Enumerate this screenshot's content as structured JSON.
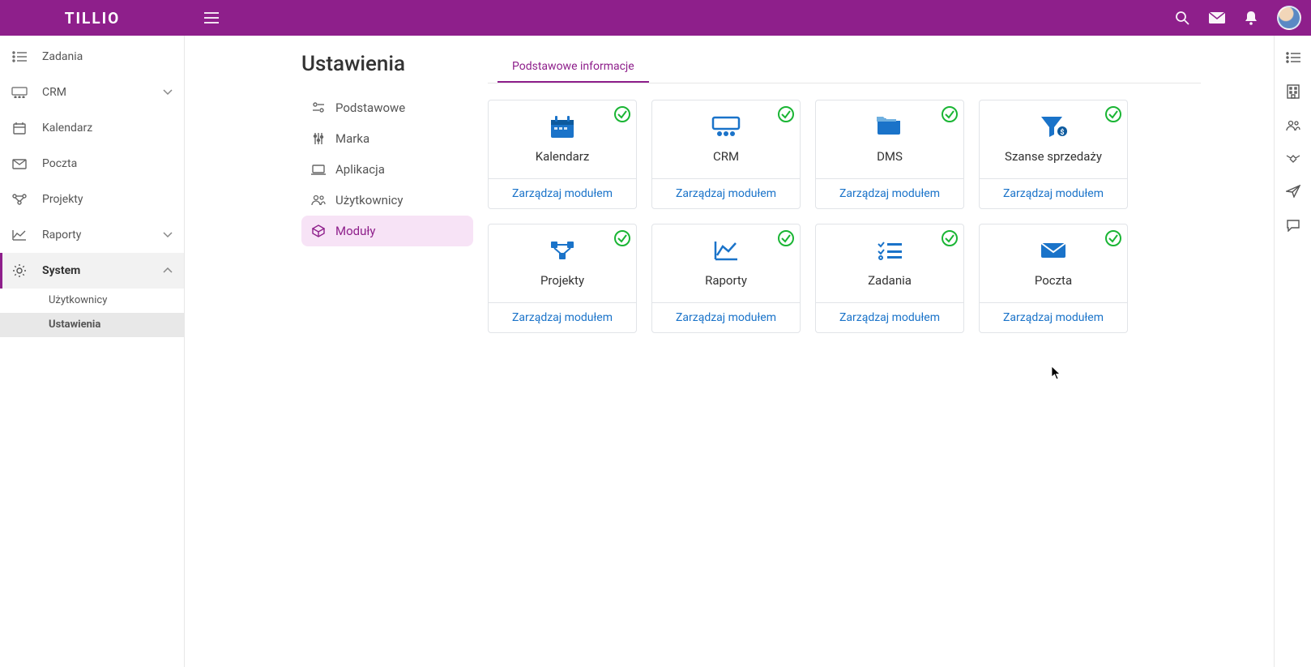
{
  "brand": "TILLIO",
  "sidebar": {
    "items": [
      {
        "label": "Zadania",
        "icon": "list",
        "expandable": false
      },
      {
        "label": "CRM",
        "icon": "crm",
        "expandable": true
      },
      {
        "label": "Kalendarz",
        "icon": "calendar",
        "expandable": false
      },
      {
        "label": "Poczta",
        "icon": "mail",
        "expandable": false
      },
      {
        "label": "Projekty",
        "icon": "projects",
        "expandable": false
      },
      {
        "label": "Raporty",
        "icon": "reports",
        "expandable": true
      },
      {
        "label": "System",
        "icon": "gear",
        "expandable": true,
        "active": true
      }
    ],
    "subitems": [
      {
        "label": "Użytkownicy"
      },
      {
        "label": "Ustawienia",
        "active": true
      }
    ]
  },
  "page_title": "Ustawienia",
  "settings_nav": [
    {
      "label": "Podstawowe",
      "icon": "sliders"
    },
    {
      "label": "Marka",
      "icon": "brand"
    },
    {
      "label": "Aplikacja",
      "icon": "app"
    },
    {
      "label": "Użytkownicy",
      "icon": "users"
    },
    {
      "label": "Moduły",
      "icon": "box",
      "active": true
    }
  ],
  "active_tab": "Podstawowe informacje",
  "manage_label": "Zarządzaj modułem",
  "modules": [
    {
      "name": "Kalendarz",
      "icon": "calendar",
      "enabled": true
    },
    {
      "name": "CRM",
      "icon": "crm",
      "enabled": true
    },
    {
      "name": "DMS",
      "icon": "dms",
      "enabled": true
    },
    {
      "name": "Szanse sprzedaży",
      "icon": "funnel",
      "enabled": true
    },
    {
      "name": "Projekty",
      "icon": "projects",
      "enabled": true
    },
    {
      "name": "Raporty",
      "icon": "reports",
      "enabled": true
    },
    {
      "name": "Zadania",
      "icon": "tasks",
      "enabled": true
    },
    {
      "name": "Poczta",
      "icon": "mail",
      "enabled": true
    }
  ],
  "colors": {
    "brand": "#8e1f8b",
    "link": "#1a73c9",
    "success": "#1ab534",
    "icon": "#1a73c9"
  }
}
